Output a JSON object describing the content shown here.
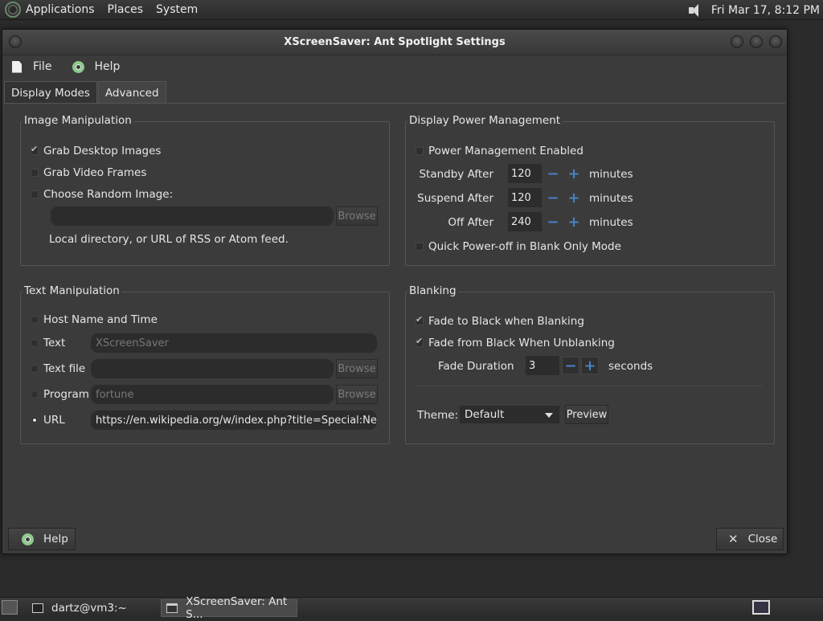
{
  "top_panel": {
    "menus": [
      "Applications",
      "Places",
      "System"
    ],
    "clock": "Fri Mar 17,  8:12 PM"
  },
  "window": {
    "title": "XScreenSaver: Ant Spotlight Settings",
    "menubar": {
      "file": "File",
      "help": "Help"
    },
    "tabs": [
      {
        "label": "Display Modes",
        "active": false
      },
      {
        "label": "Advanced",
        "active": true
      }
    ],
    "image_manipulation": {
      "label": "Image Manipulation",
      "grab_desktop": "Grab Desktop Images",
      "grab_video": "Grab Video Frames",
      "choose_random": "Choose Random Image:",
      "browse": "Browse",
      "hint": "Local directory, or URL of RSS or Atom feed."
    },
    "text_manipulation": {
      "label": "Text Manipulation",
      "host_name": "Host Name and Time",
      "text_label": "Text",
      "text_value": "XScreenSaver",
      "text_file_label": "Text file",
      "program_label": "Program",
      "program_value": "fortune",
      "url_label": "URL",
      "url_value": "https://en.wikipedia.org/w/index.php?title=Special:NewPa",
      "browse": "Browse"
    },
    "power_management": {
      "label": "Display Power Management",
      "enabled": "Power Management Enabled",
      "standby_label": "Standby After",
      "standby_value": "120",
      "suspend_label": "Suspend After",
      "suspend_value": "120",
      "off_label": "Off After",
      "off_value": "240",
      "unit": "minutes",
      "quick_off": "Quick Power-off in Blank Only Mode",
      "minus": "−",
      "plus": "+"
    },
    "blanking": {
      "label": "Blanking",
      "fade_to_black": "Fade to Black when Blanking",
      "fade_from_black": "Fade from Black When Unblanking",
      "fade_duration_label": "Fade Duration",
      "fade_duration_value": "3",
      "seconds": "seconds",
      "theme_label": "Theme:",
      "theme_value": "Default",
      "preview": "Preview"
    },
    "help_button": "Help",
    "close_button": "Close"
  },
  "taskbar": {
    "tasks": [
      "dartz@vm3:~",
      "XScreenSaver: Ant S..."
    ]
  }
}
